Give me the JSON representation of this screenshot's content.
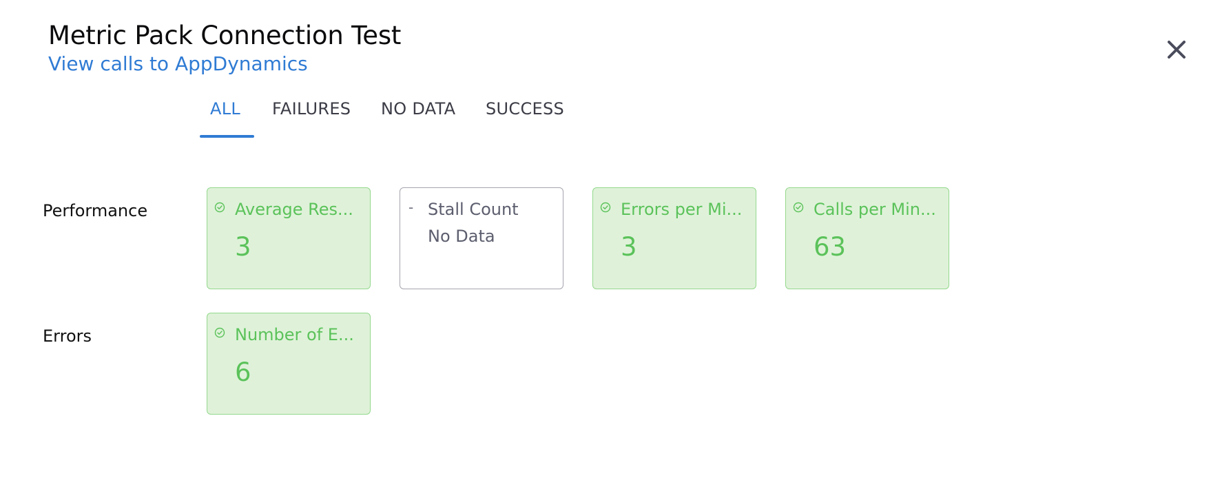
{
  "dialog": {
    "title": "Metric Pack Connection Test",
    "link": "View calls to AppDynamics",
    "close_icon": "close-icon"
  },
  "tabs": [
    {
      "label": "ALL",
      "active": true
    },
    {
      "label": "FAILURES",
      "active": false
    },
    {
      "label": "NO DATA",
      "active": false
    },
    {
      "label": "SUCCESS",
      "active": false
    }
  ],
  "groups": [
    {
      "label": "Performance",
      "metrics": [
        {
          "name": "Average Res...",
          "value": "3",
          "status": "success",
          "icon": "check-circle-icon"
        },
        {
          "name": "Stall Count",
          "value": "No Data",
          "status": "nodata",
          "icon": "dash-icon"
        },
        {
          "name": "Errors per Mi...",
          "value": "3",
          "status": "success",
          "icon": "check-circle-icon"
        },
        {
          "name": "Calls per Min...",
          "value": "63",
          "status": "success",
          "icon": "check-circle-icon"
        }
      ]
    },
    {
      "label": "Errors",
      "metrics": [
        {
          "name": "Number of E...",
          "value": "6",
          "status": "success",
          "icon": "check-circle-icon"
        }
      ]
    }
  ],
  "colors": {
    "accent": "#2f7bd4",
    "success_text": "#5bc25a",
    "success_bg": "#dff2d9",
    "success_border": "#93d88c",
    "nodata_border": "#a5a5ae"
  }
}
